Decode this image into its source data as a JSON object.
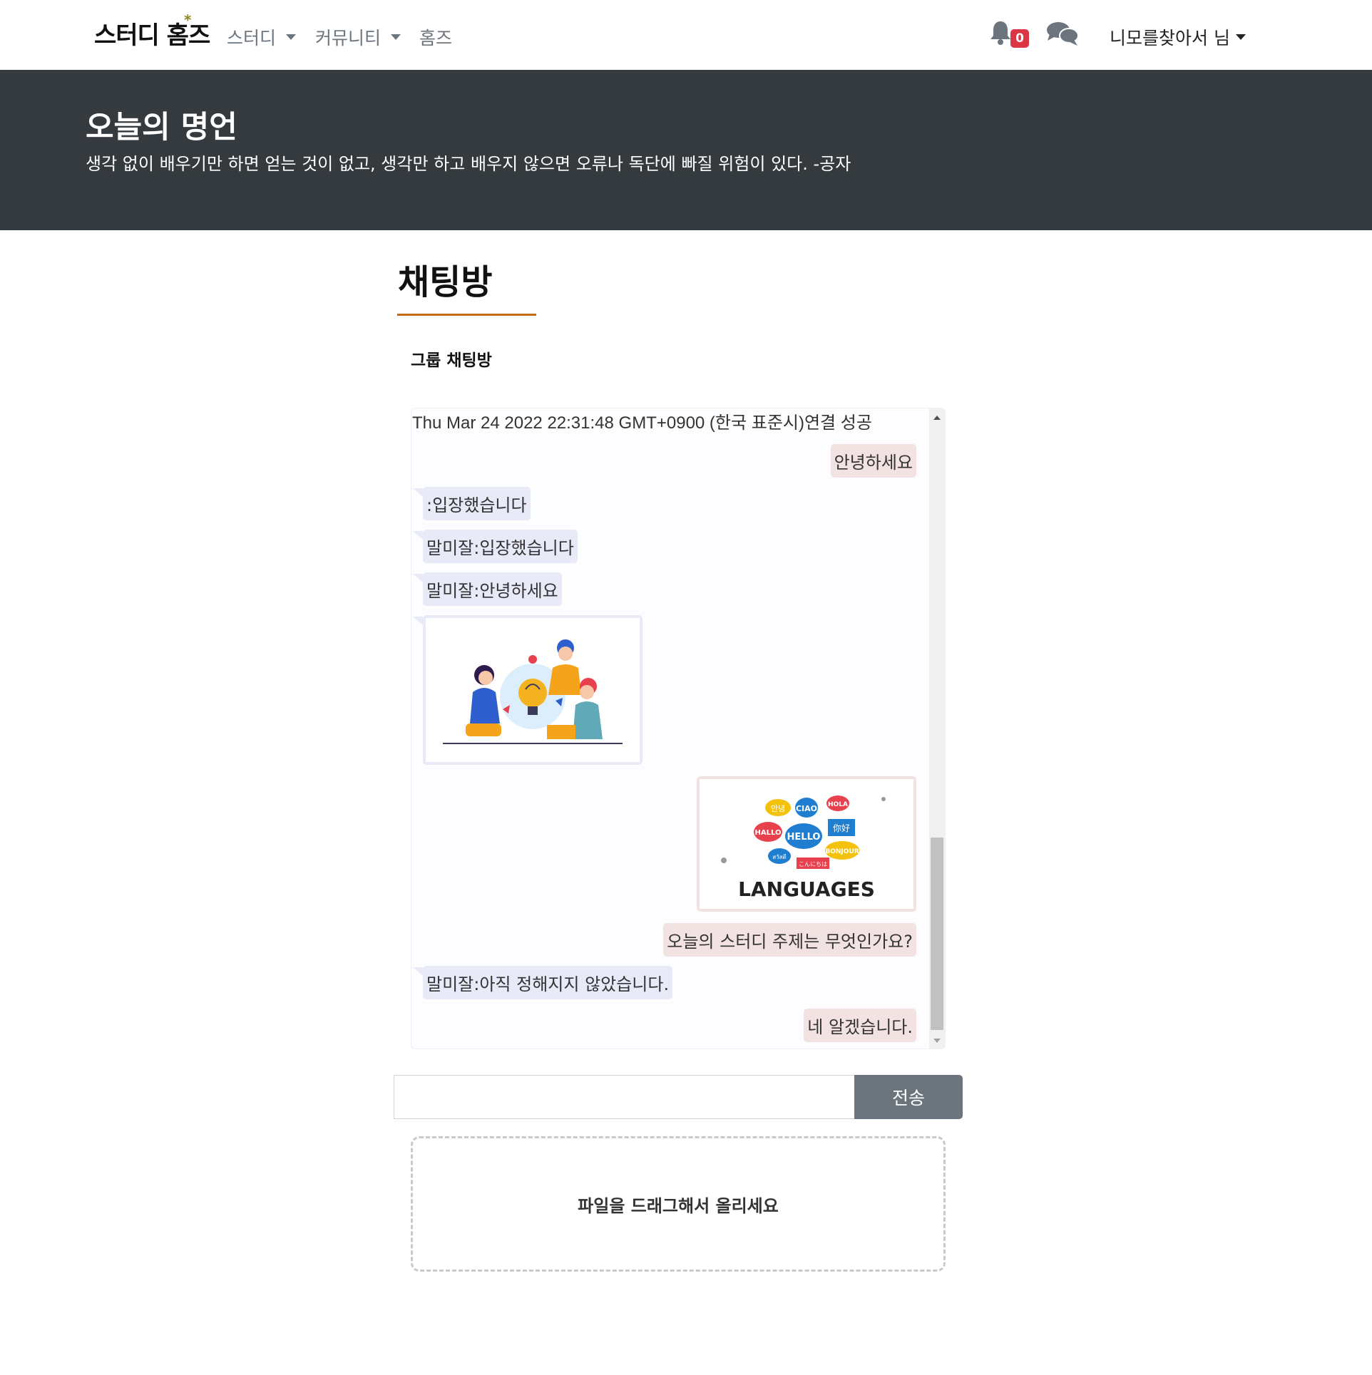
{
  "navbar": {
    "brand": "스터디 홈즈",
    "brand_mark": "*",
    "menu": [
      {
        "label": "스터디",
        "has_dropdown": true
      },
      {
        "label": "커뮤니티",
        "has_dropdown": true
      },
      {
        "label": "홈즈",
        "has_dropdown": false
      }
    ],
    "notification_icon": "bell-icon",
    "notification_count": "0",
    "chat_icon": "chat-bubbles-icon",
    "user_label": "니모를찾아서 님"
  },
  "banner": {
    "title": "오늘의 명언",
    "quote": "생각 없이 배우기만 하면 얻는 것이 없고, 생각만 하고 배우지 않으면 오류나 독단에 빠질 위험이 있다. -공자"
  },
  "page": {
    "title": "채팅방",
    "room_name": "그룹 채팅방"
  },
  "chat": {
    "system_message": "Thu Mar 24 2022 22:31:48 GMT+0900 (한국 표준시)연결 성공",
    "messages": [
      {
        "side": "mine",
        "type": "text",
        "text": "안녕하세요"
      },
      {
        "side": "other",
        "type": "text",
        "text": ":입장했습니다"
      },
      {
        "side": "other",
        "type": "text",
        "text": "말미잘:입장했습니다"
      },
      {
        "side": "other",
        "type": "text",
        "text": "말미잘:안녕하세요"
      },
      {
        "side": "other",
        "type": "image",
        "image": "team-idea-illustration"
      },
      {
        "side": "mine",
        "type": "image",
        "image": "languages-illustration",
        "caption": "LANGUAGES",
        "bubbles": [
          "안녕",
          "CIAO",
          "HOLA",
          "HALLO",
          "HELLO",
          "你好",
          "สวัสดี",
          "BONJOUR",
          "こんにちは"
        ]
      },
      {
        "side": "mine",
        "type": "text",
        "text": "오늘의 스터디 주제는 무엇인가요?"
      },
      {
        "side": "other",
        "type": "text",
        "text": "말미잘:아직 정해지지 않았습니다."
      },
      {
        "side": "mine",
        "type": "text",
        "text": "네 알겠습니다."
      }
    ]
  },
  "composer": {
    "input_value": "",
    "send_label": "전송"
  },
  "dropzone": {
    "label": "파일을 드래그해서 올리세요"
  },
  "colors": {
    "banner_bg": "#343a3e",
    "title_underline": "#c06a12",
    "my_bubble": "#f3e2e2",
    "other_bubble": "#e9eaf8",
    "send_button": "#6c757d",
    "badge": "#dc3545"
  }
}
